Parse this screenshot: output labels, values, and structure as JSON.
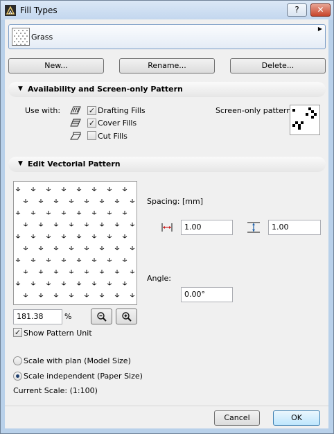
{
  "window": {
    "title": "Fill Types",
    "help_label": "?",
    "close_label": "✕"
  },
  "fill_selector": {
    "name": "Grass"
  },
  "actions": {
    "new_label": "New...",
    "rename_label": "Rename...",
    "delete_label": "Delete..."
  },
  "availability": {
    "header": "Availability and Screen-only Pattern",
    "use_with_label": "Use with:",
    "options": [
      {
        "label": "Drafting Fills",
        "checked": true
      },
      {
        "label": "Cover Fills",
        "checked": true
      },
      {
        "label": "Cut Fills",
        "checked": false
      }
    ],
    "screen_only_label": "Screen-only pattern:"
  },
  "vectorial": {
    "header": "Edit Vectorial Pattern",
    "zoom_value": "181.38",
    "zoom_unit": "%",
    "show_unit_label": "Show Pattern Unit",
    "show_unit_checked": true,
    "spacing_label": "Spacing: [mm]",
    "spacing_x": "1.00",
    "spacing_y": "1.00",
    "angle_label": "Angle:",
    "angle_value": "0.00°",
    "scale_plan_label": "Scale with plan (Model Size)",
    "scale_indep_label": "Scale independent (Paper Size)",
    "selected_scale": "independent",
    "current_scale_label": "Current Scale:  (1:100)"
  },
  "footer": {
    "cancel_label": "Cancel",
    "ok_label": "OK"
  },
  "colors": {
    "title_bar": "#c2d6ee",
    "client_bg": "#f0f0f0",
    "close_button": "#c7442b",
    "accent_border": "#7a9cc6"
  },
  "icons": {
    "app": "archicad-icon",
    "zoom_out": "zoom-out-icon",
    "zoom_in": "zoom-in-icon",
    "spacing_x": "horizontal-spacing-icon",
    "spacing_y": "vertical-spacing-icon"
  }
}
